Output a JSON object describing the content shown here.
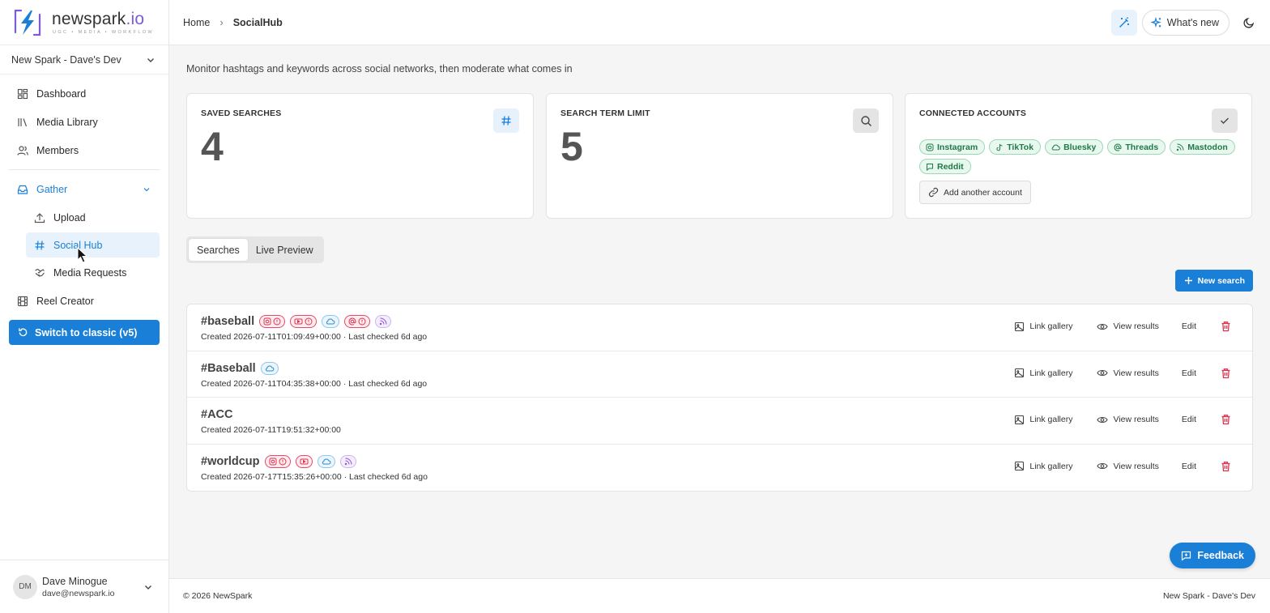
{
  "brand": {
    "name": "newspark",
    "suffix": ".io",
    "tagline": "UGC • MEDIA • WORKFLOW"
  },
  "org_selector": {
    "label": "New Spark - Dave's Dev"
  },
  "nav": {
    "dashboard": "Dashboard",
    "media_library": "Media Library",
    "members": "Members",
    "gather": "Gather",
    "upload": "Upload",
    "social_hub": "Social Hub",
    "media_requests": "Media Requests",
    "reel_creator": "Reel Creator",
    "switch_classic": "Switch to classic (v5)"
  },
  "user": {
    "initials": "DM",
    "name": "Dave Minogue",
    "email": "dave@newspark.io"
  },
  "header": {
    "breadcrumb_home": "Home",
    "breadcrumb_current": "SocialHub",
    "whats_new": "What's new"
  },
  "page": {
    "subtitle": "Monitor hashtags and keywords across social networks, then moderate what comes in"
  },
  "stats": {
    "saved_searches": {
      "label": "SAVED SEARCHES",
      "value": "4"
    },
    "term_limit": {
      "label": "SEARCH TERM LIMIT",
      "value": "5"
    },
    "connected": {
      "label": "CONNECTED ACCOUNTS",
      "accounts": [
        "Instagram",
        "TikTok",
        "Bluesky",
        "Threads",
        "Mastodon",
        "Reddit"
      ],
      "add_label": "Add another account"
    }
  },
  "tabs": [
    "Searches",
    "Live Preview"
  ],
  "new_search_label": "New search",
  "actions": {
    "link_gallery": "Link gallery",
    "view_results": "View results",
    "edit": "Edit"
  },
  "searches": [
    {
      "term": "#baseball",
      "meta": "Created 2026-07-11T01:09:49+00:00 · Last checked 6d ago",
      "badges": [
        "instagram-warning",
        "youtube-warning",
        "bluesky",
        "threads-warning",
        "mastodon"
      ]
    },
    {
      "term": "#Baseball",
      "meta": "Created 2026-07-11T04:35:38+00:00 · Last checked 6d ago",
      "badges": [
        "bluesky"
      ]
    },
    {
      "term": "#ACC",
      "meta": "Created 2026-07-11T19:51:32+00:00",
      "badges": []
    },
    {
      "term": "#worldcup",
      "meta": "Created 2026-07-17T15:35:26+00:00 · Last checked 6d ago",
      "badges": [
        "instagram-warning",
        "youtube",
        "bluesky",
        "mastodon"
      ]
    }
  ],
  "feedback_label": "Feedback",
  "footer": {
    "copyright": "© 2026 NewSpark",
    "org": "New Spark - Dave's Dev"
  },
  "colors": {
    "accent": "#1a7fd6",
    "danger": "#e0314f",
    "success": "#1e7a46",
    "mastodon": "#8a4fd8"
  }
}
